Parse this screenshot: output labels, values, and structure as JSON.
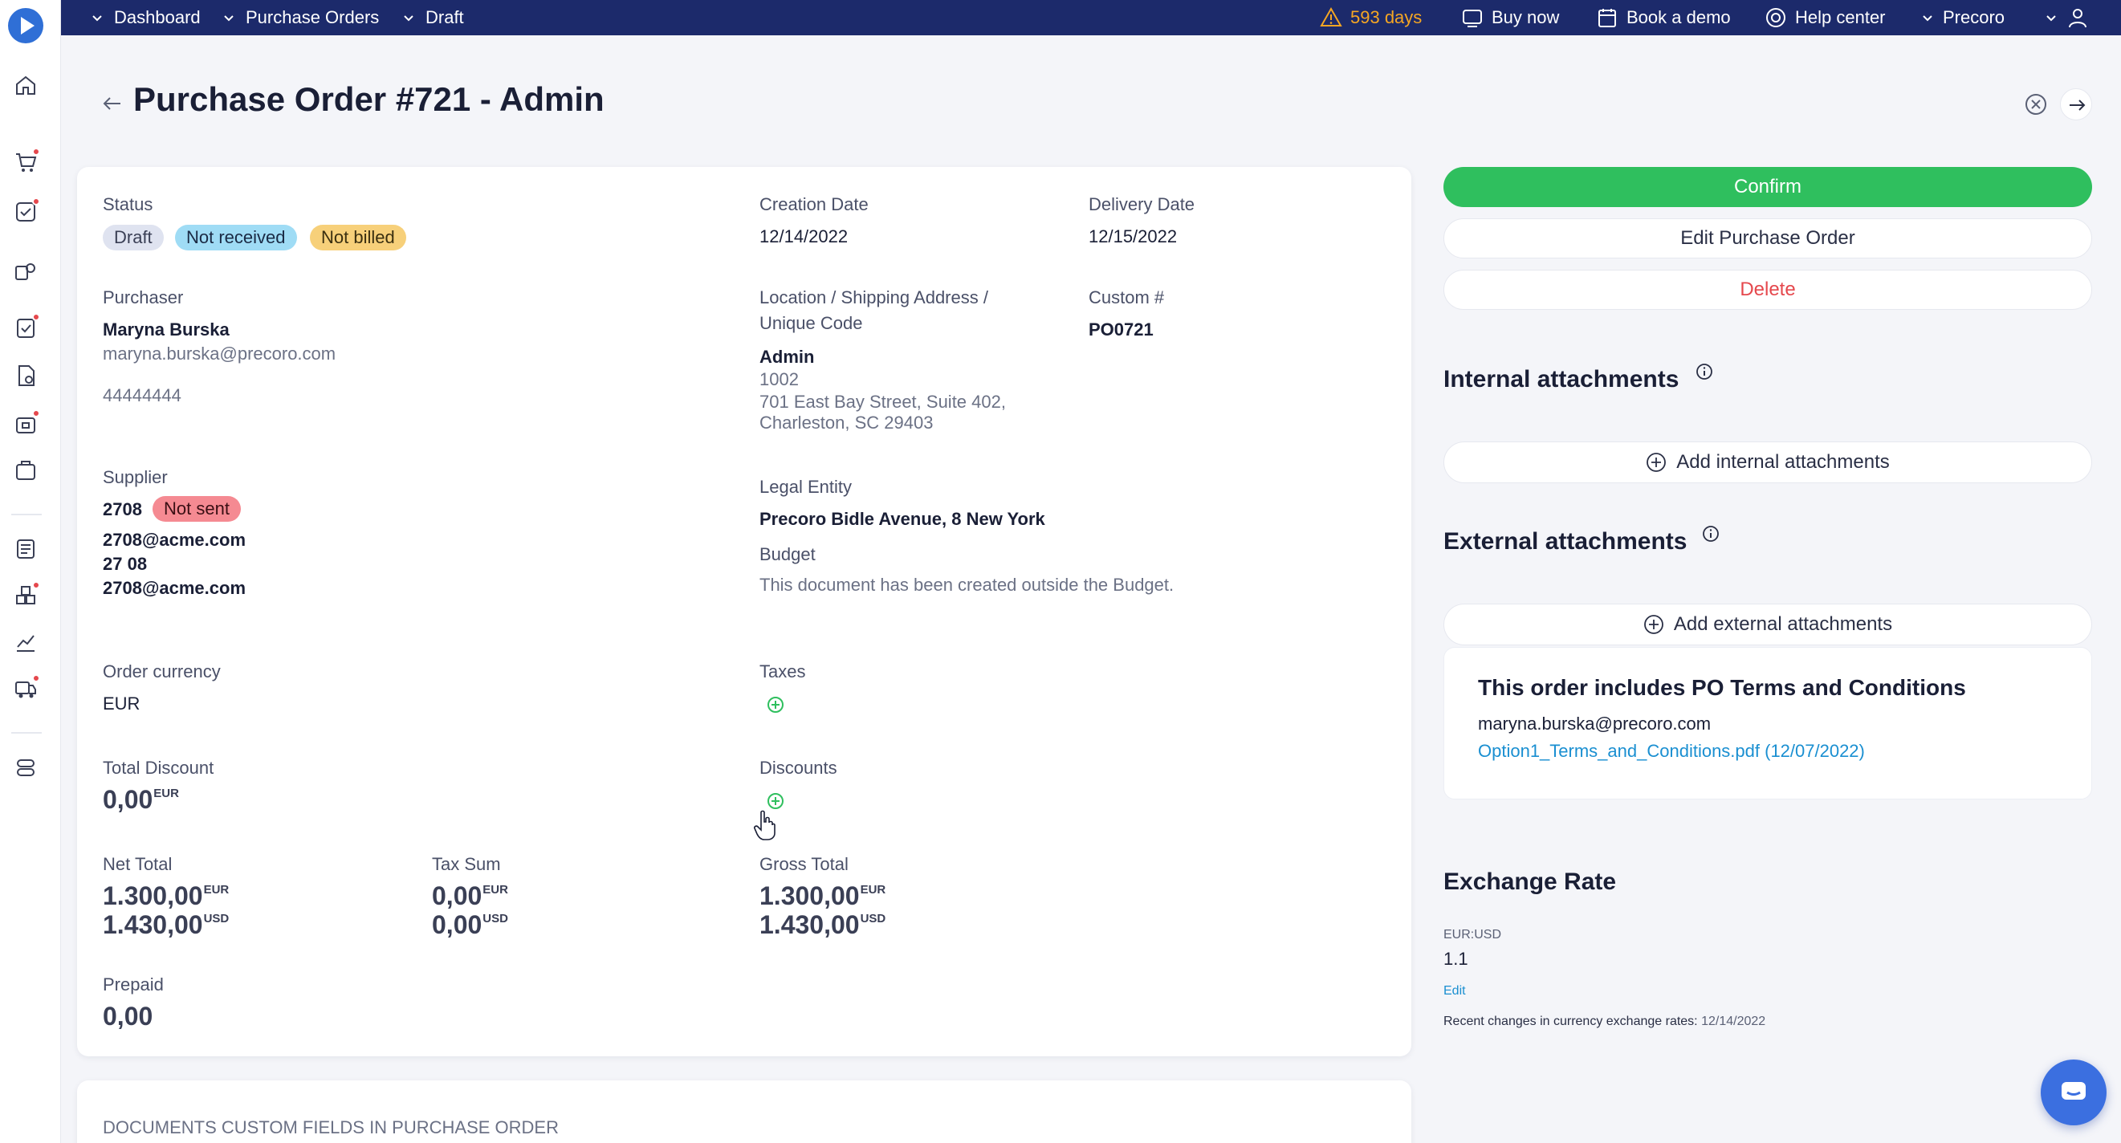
{
  "topbar": {
    "breadcrumbs": [
      "Dashboard",
      "Purchase Orders",
      "Draft"
    ],
    "warning_days": "593 days",
    "buy_now": "Buy now",
    "book_demo": "Book a demo",
    "help_center": "Help center",
    "account": "Precoro"
  },
  "page": {
    "title": "Purchase Order #721 - Admin"
  },
  "details": {
    "status_label": "Status",
    "status_badges": [
      "Draft",
      "Not received",
      "Not billed"
    ],
    "creation_date_label": "Creation Date",
    "creation_date": "12/14/2022",
    "delivery_date_label": "Delivery Date",
    "delivery_date": "12/15/2022",
    "purchaser_label": "Purchaser",
    "purchaser_name": "Maryna Burska",
    "purchaser_email": "maryna.burska@precoro.com",
    "purchaser_phone": "44444444",
    "location_label_1": "Location / Shipping Address /",
    "location_label_2": "Unique Code",
    "location_name": "Admin",
    "location_code": "1002",
    "location_address_1": "701 East Bay Street, Suite 402,",
    "location_address_2": "Charleston, SC 29403",
    "custom_label": "Custom #",
    "custom_value": "PO0721",
    "supplier_label": "Supplier",
    "supplier_name": "2708",
    "supplier_status": "Not sent",
    "supplier_email": "2708@acme.com",
    "supplier_contact": "27 08",
    "supplier_email_2": "2708@acme.com",
    "legal_entity_label": "Legal Entity",
    "legal_entity": "Precoro Bidle Avenue, 8 New York",
    "budget_label": "Budget",
    "budget_text": "This document has been created outside the Budget.",
    "order_currency_label": "Order currency",
    "order_currency": "EUR",
    "taxes_label": "Taxes",
    "total_discount_label": "Total Discount",
    "total_discount": "0,00",
    "discounts_label": "Discounts",
    "net_total_label": "Net Total",
    "net_total_eur": "1.300,00",
    "net_total_usd": "1.430,00",
    "tax_sum_label": "Tax Sum",
    "tax_sum_eur": "0,00",
    "tax_sum_usd": "0,00",
    "gross_total_label": "Gross Total",
    "gross_total_eur": "1.300,00",
    "gross_total_usd": "1.430,00",
    "prepaid_label": "Prepaid",
    "prepaid": "0,00",
    "currency_eur": "EUR",
    "currency_usd": "USD"
  },
  "custom_fields": {
    "title": "DOCUMENTS CUSTOM FIELDS IN PURCHASE ORDER"
  },
  "actions": {
    "confirm": "Confirm",
    "edit": "Edit Purchase Order",
    "delete": "Delete"
  },
  "attachments": {
    "internal_title": "Internal attachments",
    "add_internal": "Add internal attachments",
    "external_title": "External attachments",
    "add_external": "Add external attachments"
  },
  "terms": {
    "title": "This order includes PO Terms and Conditions",
    "email": "maryna.burska@precoro.com",
    "file": "Option1_Terms_and_Conditions.pdf (12/07/2022)"
  },
  "exchange": {
    "title": "Exchange Rate",
    "pair": "EUR:USD",
    "rate": "1.1",
    "edit": "Edit",
    "recent_label": "Recent changes in currency exchange rates:",
    "recent_date": "12/14/2022"
  },
  "colors": {
    "topbar": "#1c2a6b",
    "confirm": "#2fbf5e",
    "badge_draft": "#dfe3f0",
    "badge_not_received": "#9fdcf5",
    "badge_not_billed": "#f7d07a",
    "badge_not_sent": "#f58a92",
    "link": "#1a8fd1"
  }
}
